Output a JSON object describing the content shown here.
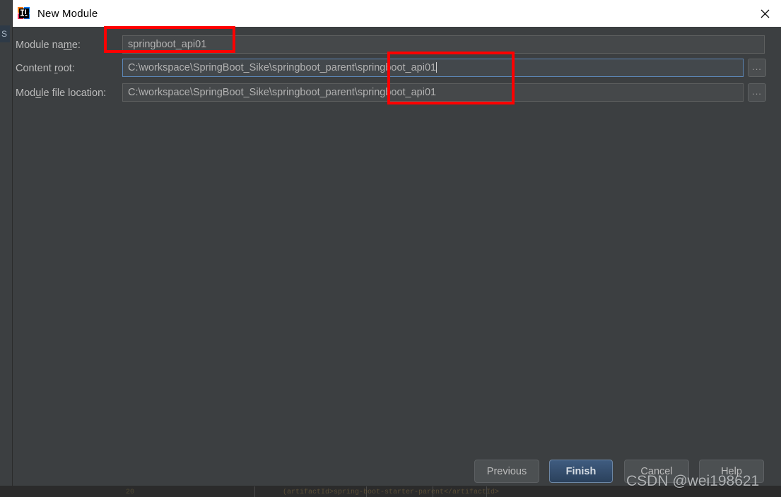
{
  "window": {
    "title": "New Module",
    "icon": "intellij-idea-logo",
    "close_icon": "close-icon"
  },
  "background": {
    "left_tab_label": "S",
    "code_snippet": "(artifactId>spring-boot-starter-parent</artifactId>",
    "line_number": "20"
  },
  "form": {
    "rows": [
      {
        "label_pre": "Module na",
        "label_mnemonic": "m",
        "label_post": "e:",
        "label_full": "Module name:",
        "value": "springboot_api01",
        "has_browse": false,
        "focused": false,
        "caret": false
      },
      {
        "label_pre": "Content ",
        "label_mnemonic": "r",
        "label_post": "oot:",
        "label_full": "Content root:",
        "value": "C:\\workspace\\SpringBoot_Sike\\springboot_parent\\springboot_api01",
        "has_browse": true,
        "browse_label": "...",
        "focused": true,
        "caret": true
      },
      {
        "label_pre": "Mod",
        "label_mnemonic": "u",
        "label_post": "le file location:",
        "label_full": "Module file location:",
        "value": "C:\\workspace\\SpringBoot_Sike\\springboot_parent\\springboot_api01",
        "has_browse": true,
        "browse_label": "...",
        "focused": false,
        "caret": false
      }
    ]
  },
  "annotations": {
    "accent_color": "#ff0000",
    "boxes": [
      {
        "name": "module-name-highlight",
        "target": "module-name-field"
      },
      {
        "name": "path-suffix-highlight",
        "target": "content-root-and-module-file-suffix"
      }
    ]
  },
  "buttons": {
    "previous": "Previous",
    "finish": "Finish",
    "cancel": "Cancel",
    "help": "Help"
  },
  "watermark": {
    "text": "CSDN @wei198621"
  },
  "colors": {
    "dialog_bg": "#3c3f41",
    "field_bg": "#45484a",
    "focus_border": "#5c86b6",
    "primary_button": "#35506f",
    "text": "#bbbbbb",
    "titlebar_bg": "#ffffff"
  }
}
